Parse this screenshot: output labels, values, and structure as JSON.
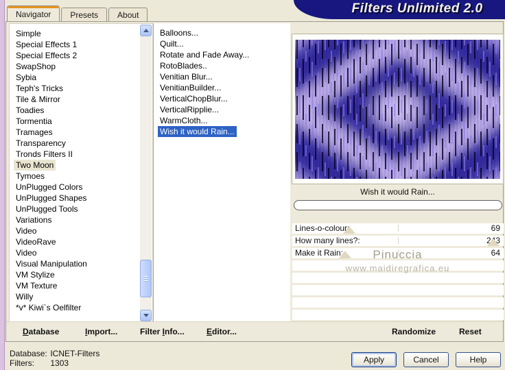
{
  "window": {
    "banner_title": "Filters Unlimited 2.0"
  },
  "tabs": [
    {
      "label": "Navigator",
      "active": true
    },
    {
      "label": "Presets",
      "active": false
    },
    {
      "label": "About",
      "active": false
    }
  ],
  "category_list": {
    "items": [
      "Simple",
      "Special Effects 1",
      "Special Effects 2",
      "SwapShop",
      "Sybia",
      "Teph's Tricks",
      "Tile & Mirror",
      "Toadies",
      "Tormentia",
      "Tramages",
      "Transparency",
      "Tronds Filters II",
      "Two Moon",
      "Tymoes",
      "UnPlugged Colors",
      "UnPlugged Shapes",
      "UnPlugged Tools",
      "Variations",
      "Video",
      "VideoRave",
      "Video",
      "Visual Manipulation",
      "VM Stylize",
      "VM Texture",
      "Willy",
      "*v* Kiwi`s Oelfilter"
    ],
    "selected": "Two Moon"
  },
  "filter_list": {
    "items": [
      "Balloons...",
      "Quilt...",
      "Rotate and Fade Away...",
      "RotoBlades..",
      "Venitian Blur...",
      "VenitianBuilder...",
      "VerticalChopBlur...",
      "VerticalRipplie...",
      "WarmCloth...",
      "Wish it would Rain..."
    ],
    "selected": "Wish it would Rain..."
  },
  "preview": {
    "caption": "Wish it would Rain...",
    "progress_percent": 0
  },
  "sliders": [
    {
      "label": "Lines-o-colour:",
      "value": "69",
      "percent": 27
    },
    {
      "label": "How many lines?:",
      "value": "243",
      "percent": 95
    },
    {
      "label": "Make it Rain:",
      "value": "64",
      "percent": 25
    }
  ],
  "empty_param_rows": 5,
  "watermark": {
    "line1": "Pinuccia",
    "line2": "www.maidiregrafica.eu"
  },
  "toolbar": {
    "items": [
      {
        "pre": "",
        "accel": "D",
        "rest": "atabase"
      },
      {
        "pre": "",
        "accel": "I",
        "rest": "mport..."
      },
      {
        "pre": "Filter ",
        "accel": "I",
        "rest": "nfo..."
      },
      {
        "pre": "",
        "accel": "E",
        "rest": "ditor..."
      }
    ],
    "randomize_label": "Randomize",
    "reset_label": "Reset"
  },
  "status": {
    "database_label": "Database:",
    "database_value": "ICNET-Filters",
    "filters_label": "Filters:",
    "filters_value": "1303"
  },
  "buttons": {
    "apply": "Apply",
    "cancel": "Cancel",
    "help": "Help"
  },
  "colors": {
    "banner": "#17177f",
    "selection_blue": "#2e62c4",
    "inactive_selection": "#e9e5d1",
    "preview_light": "#b1a0e6",
    "preview_lighter": "#cbbcf3",
    "preview_dark": "#332a9e",
    "tab_accent_orange": "#e79420"
  }
}
